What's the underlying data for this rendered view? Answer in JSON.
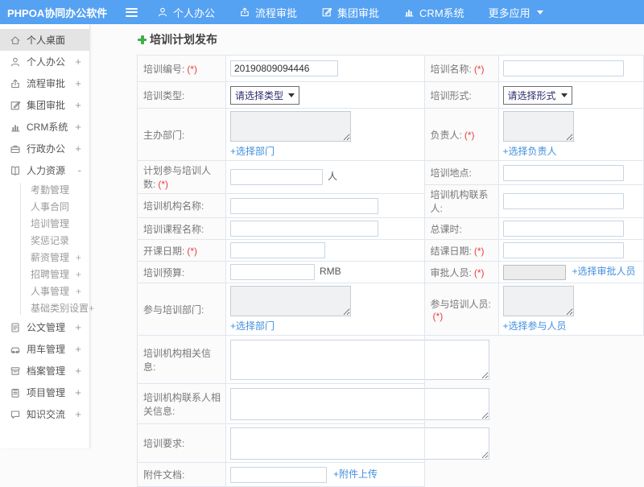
{
  "colors": {
    "header_blue": "#55a1f2",
    "link_blue": "#418fde",
    "required_red": "#ee3b3b",
    "plus_green": "#3fae49"
  },
  "header": {
    "logo": "PHPOA协同办公软件",
    "nav": [
      {
        "key": "personal-office",
        "label": "个人办公",
        "icon": "user-icon"
      },
      {
        "key": "workflow-approval",
        "label": "流程审批",
        "icon": "flow-icon"
      },
      {
        "key": "group-approval",
        "label": "集团审批",
        "icon": "edit-icon"
      },
      {
        "key": "crm-system",
        "label": "CRM系统",
        "icon": "chart-icon"
      },
      {
        "key": "more-apps",
        "label": "更多应用",
        "icon": null,
        "caret": true
      }
    ]
  },
  "sidebar": {
    "items": [
      {
        "key": "personal-desktop",
        "label": "个人桌面",
        "icon": "home-icon",
        "active": true
      },
      {
        "key": "personal-office",
        "label": "个人办公",
        "icon": "user-icon",
        "toggle": "+"
      },
      {
        "key": "workflow-approval",
        "label": "流程审批",
        "icon": "flow-icon",
        "toggle": "+"
      },
      {
        "key": "group-approval",
        "label": "集团审批",
        "icon": "edit-icon",
        "toggle": "+"
      },
      {
        "key": "crm-system",
        "label": "CRM系统",
        "icon": "chart-icon",
        "toggle": "+"
      },
      {
        "key": "admin-office",
        "label": "行政办公",
        "icon": "briefcase-icon",
        "toggle": "+"
      },
      {
        "key": "human-resources",
        "label": "人力资源",
        "icon": "book-icon",
        "toggle": "-",
        "children": [
          {
            "key": "attendance-mgmt",
            "label": "考勤管理"
          },
          {
            "key": "hr-contract",
            "label": "人事合同"
          },
          {
            "key": "training-mgmt",
            "label": "培训管理"
          },
          {
            "key": "reward-punishment",
            "label": "奖惩记录"
          },
          {
            "key": "salary-mgmt",
            "label": "薪资管理",
            "toggle": "+"
          },
          {
            "key": "recruit-mgmt",
            "label": "招聘管理",
            "toggle": "+"
          },
          {
            "key": "personnel-mgmt",
            "label": "人事管理",
            "toggle": "+"
          },
          {
            "key": "base-category-settings",
            "label": "基础类别设置",
            "toggle": "+"
          }
        ]
      },
      {
        "key": "document-mgmt",
        "label": "公文管理",
        "icon": "doc-icon",
        "toggle": "+"
      },
      {
        "key": "vehicle-mgmt",
        "label": "用车管理",
        "icon": "car-icon",
        "toggle": "+"
      },
      {
        "key": "archive-mgmt",
        "label": "档案管理",
        "icon": "archive-icon",
        "toggle": "+"
      },
      {
        "key": "project-mgmt",
        "label": "项目管理",
        "icon": "clipboard-icon",
        "toggle": "+"
      },
      {
        "key": "knowledge-exchange",
        "label": "知识交流",
        "icon": "chat-icon",
        "toggle": "+"
      }
    ]
  },
  "page": {
    "title": "培训计划发布"
  },
  "form": {
    "required_mark": "(*)",
    "left_rows": [
      {
        "key": "training-number",
        "label": "培训编号:",
        "required": true,
        "type": "input",
        "value": "20190809094446"
      },
      {
        "key": "training-type",
        "label": "培训类型:",
        "type": "select",
        "value": "请选择类型"
      },
      {
        "key": "host-department",
        "label": "主办部门:",
        "type": "textarea",
        "link": "+选择部门"
      },
      {
        "key": "planned-participants",
        "label": "计划参与培训人数:",
        "required": true,
        "type": "input",
        "suffix": "人"
      },
      {
        "key": "org-name",
        "label": "培训机构名称:",
        "type": "input"
      },
      {
        "key": "course-name",
        "label": "培训课程名称:",
        "type": "input"
      },
      {
        "key": "start-date",
        "label": "开课日期:",
        "required": true,
        "type": "input"
      },
      {
        "key": "budget",
        "label": "培训预算:",
        "type": "input",
        "suffix": "RMB"
      },
      {
        "key": "participating-departments",
        "label": "参与培训部门:",
        "type": "textarea",
        "link": "+选择部门"
      },
      {
        "key": "org-info",
        "label": "培训机构相关信息:",
        "type": "bigtextarea"
      },
      {
        "key": "org-contact-info",
        "label": "培训机构联系人相关信息:",
        "type": "bigtextarea"
      },
      {
        "key": "training-requirements",
        "label": "培训要求:",
        "type": "bigtextarea"
      },
      {
        "key": "attachment",
        "label": "附件文档:",
        "type": "file",
        "link": "+附件上传"
      }
    ],
    "right_rows": [
      {
        "key": "training-name",
        "label": "培训名称:",
        "required": true,
        "type": "input"
      },
      {
        "key": "training-form",
        "label": "培训形式:",
        "type": "select",
        "value": "请选择形式"
      },
      {
        "key": "leader",
        "label": "负责人:",
        "required": true,
        "type": "textarea",
        "link": "+选择负责人"
      },
      {
        "key": "location",
        "label": "培训地点:",
        "type": "input"
      },
      {
        "key": "org-contact",
        "label": "培训机构联系人:",
        "type": "input"
      },
      {
        "key": "total-hours",
        "label": "总课时:",
        "type": "input"
      },
      {
        "key": "end-date",
        "label": "结课日期:",
        "required": true,
        "type": "input"
      },
      {
        "key": "approvers",
        "label": "审批人员:",
        "required": true,
        "type": "input-readonly",
        "link": "+选择审批人员"
      },
      {
        "key": "participants",
        "label": "参与培训人员:",
        "required": true,
        "type": "textarea",
        "link": "+选择参与人员"
      }
    ]
  }
}
